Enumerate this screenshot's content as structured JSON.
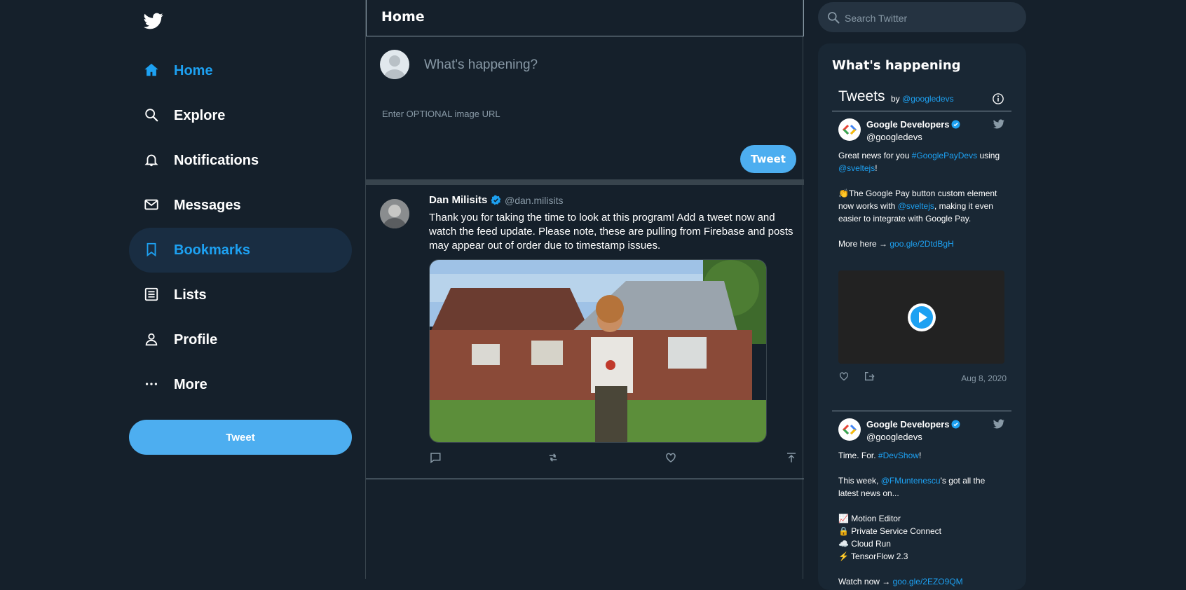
{
  "nav": {
    "items": [
      {
        "label": "Home",
        "icon": "home-icon"
      },
      {
        "label": "Explore",
        "icon": "search-icon"
      },
      {
        "label": "Notifications",
        "icon": "bell-icon"
      },
      {
        "label": "Messages",
        "icon": "envelope-icon"
      },
      {
        "label": "Bookmarks",
        "icon": "bookmark-icon"
      },
      {
        "label": "Lists",
        "icon": "list-icon"
      },
      {
        "label": "Profile",
        "icon": "person-icon"
      },
      {
        "label": "More",
        "icon": "more-icon"
      }
    ],
    "tweet_button": "Tweet"
  },
  "header": {
    "title": "Home"
  },
  "compose": {
    "placeholder": "What's happening?",
    "image_url_placeholder": "Enter OPTIONAL image URL",
    "tweet_button": "Tweet"
  },
  "feed": {
    "tweet": {
      "name": "Dan Milisits",
      "handle": "@dan.milisits",
      "text": "Thank you for taking the time to look at this program! Add a tweet now and watch the feed update. Please note, these are pulling from Firebase and posts may appear out of order due to timestamp issues."
    }
  },
  "search": {
    "placeholder": "Search Twitter"
  },
  "sidebar": {
    "title": "What's happening",
    "widget": {
      "title": "Tweets",
      "by": "by",
      "by_handle": "@googledevs",
      "tweets": [
        {
          "name": "Google Developers",
          "handle": "@googledevs",
          "p1a": "Great news for you ",
          "p1tag": "#GooglePayDevs",
          "p1b": " using ",
          "p1link": "@sveltejs",
          "p1c": "!",
          "p2a": "👏The Google Pay button custom element now works with ",
          "p2link": "@sveltejs",
          "p2b": ", making it even easier to integrate with Google Pay.",
          "p3a": "More here → ",
          "p3link": "goo.gle/2DtdBgH",
          "date": "Aug 8, 2020"
        },
        {
          "name": "Google Developers",
          "handle": "@googledevs",
          "p1a": "Time. For. ",
          "p1tag": "#DevShow",
          "p1b": "!",
          "p2a": "This week, ",
          "p2link": "@FMuntenescu",
          "p2b": "'s got all the latest news on...",
          "list": [
            "📈 Motion Editor",
            "🔒 Private Service Connect",
            "☁️ Cloud Run",
            "⚡ TensorFlow 2.3"
          ],
          "p3a": "Watch now → ",
          "p3link": "goo.gle/2EZO9QM"
        }
      ]
    }
  },
  "colors": {
    "background": "#15202b",
    "accent": "#1da1f2",
    "button": "#4daef0",
    "border": "#38444d",
    "muted": "#8899a6"
  }
}
